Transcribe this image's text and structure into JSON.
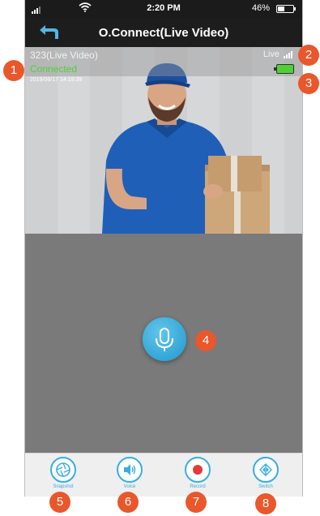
{
  "status_bar": {
    "time": "2:20 PM",
    "battery_percent": "46%",
    "battery_level": 0.46
  },
  "nav": {
    "title": "O.Connect(Live Video)",
    "back_icon": "back-arrow-icon"
  },
  "video": {
    "camera_name": "323(Live Video)",
    "connection_status": "Connected",
    "timestamp": "2019/06/17 14:19:39",
    "live_label": "Live",
    "camera_battery_icon": "battery-icon"
  },
  "mic": {
    "icon": "microphone-icon"
  },
  "toolbar": {
    "items": [
      {
        "label": "Snapshot",
        "icon": "shutter-icon"
      },
      {
        "label": "Voice",
        "icon": "speaker-icon"
      },
      {
        "label": "Record",
        "icon": "record-icon"
      },
      {
        "label": "Switch",
        "icon": "switch-icon"
      }
    ]
  },
  "callouts": [
    "1",
    "2",
    "3",
    "4",
    "5",
    "6",
    "7",
    "8"
  ],
  "colors": {
    "accent": "#35aee0",
    "connected": "#4cd137",
    "callout": "#e9572b"
  }
}
